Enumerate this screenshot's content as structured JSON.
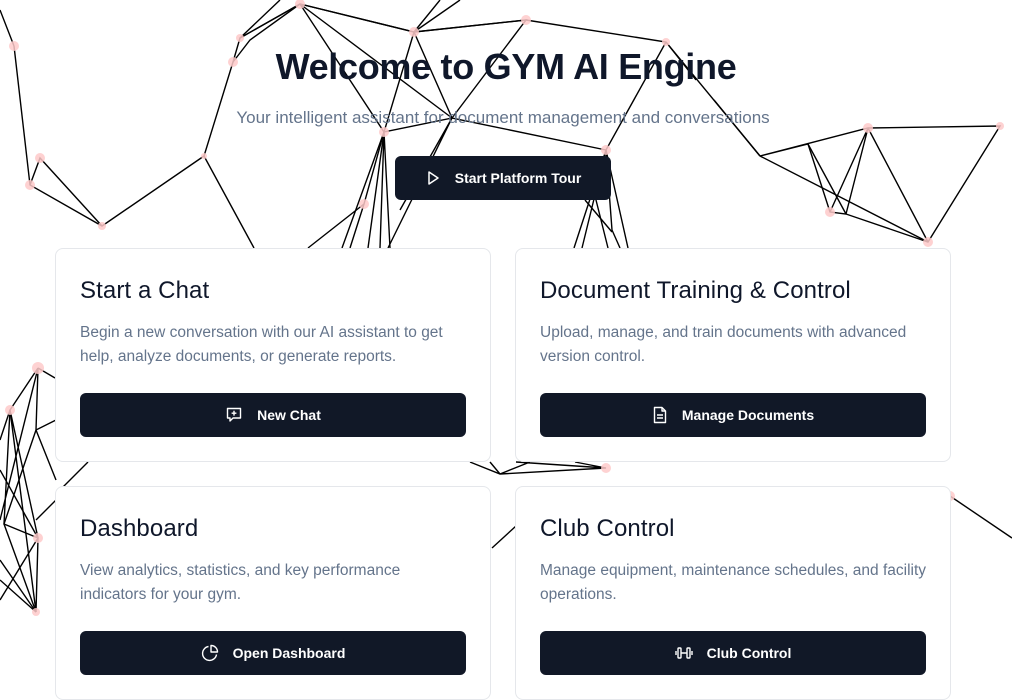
{
  "hero": {
    "title": "Welcome to GYM AI Engine",
    "subtitle": "Your intelligent assistant for document management and conversations",
    "tour_button_label": "Start Platform Tour"
  },
  "cards": [
    {
      "title": "Start a Chat",
      "description": "Begin a new conversation with our AI assistant to get help, analyze documents, or generate reports.",
      "button_label": "New Chat",
      "button_icon": "message-plus-icon"
    },
    {
      "title": "Document Training & Control",
      "description": "Upload, manage, and train documents with advanced version control.",
      "button_label": "Manage Documents",
      "button_icon": "file-icon"
    },
    {
      "title": "Dashboard",
      "description": "View analytics, statistics, and key performance indicators for your gym.",
      "button_label": "Open Dashboard",
      "button_icon": "pie-chart-icon"
    },
    {
      "title": "Club Control",
      "description": "Manage equipment, maintenance schedules, and facility operations.",
      "button_label": "Club Control",
      "button_icon": "dumbbell-icon"
    }
  ],
  "colors": {
    "primary_button": "#111827",
    "title_text": "#0f172a",
    "muted_text": "#64748b",
    "network_node": "#fecaca",
    "network_line": "#000000"
  }
}
